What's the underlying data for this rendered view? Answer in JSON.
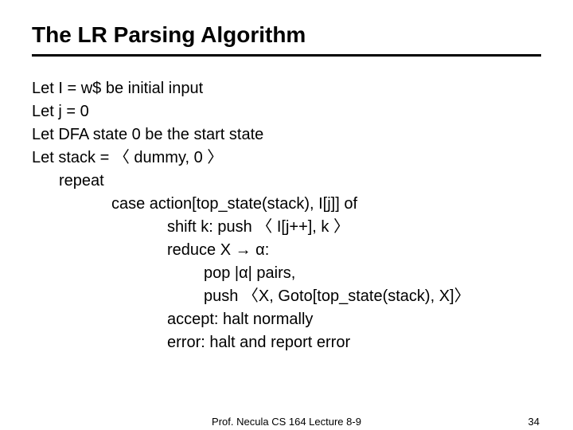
{
  "title": "The LR Parsing Algorithm",
  "lines": {
    "l1": "Let I = w$ be initial input",
    "l2": "Let j = 0",
    "l3": "Let DFA state 0 be the start state",
    "l4": "Let stack = 〈 dummy, 0 〉",
    "l5": "repeat",
    "l6": "case action[top_state(stack), I[j]] of",
    "l7": "shift k:  push 〈 I[j++], k 〉",
    "l8": "reduce X → α:",
    "l9": "pop |α| pairs,",
    "l10": "push 〈X, Goto[top_state(stack), X]〉",
    "l11": "accept: halt normally",
    "l12": "error: halt and report error"
  },
  "footer": {
    "center": "Prof. Necula  CS 164  Lecture 8-9",
    "page": "34"
  }
}
